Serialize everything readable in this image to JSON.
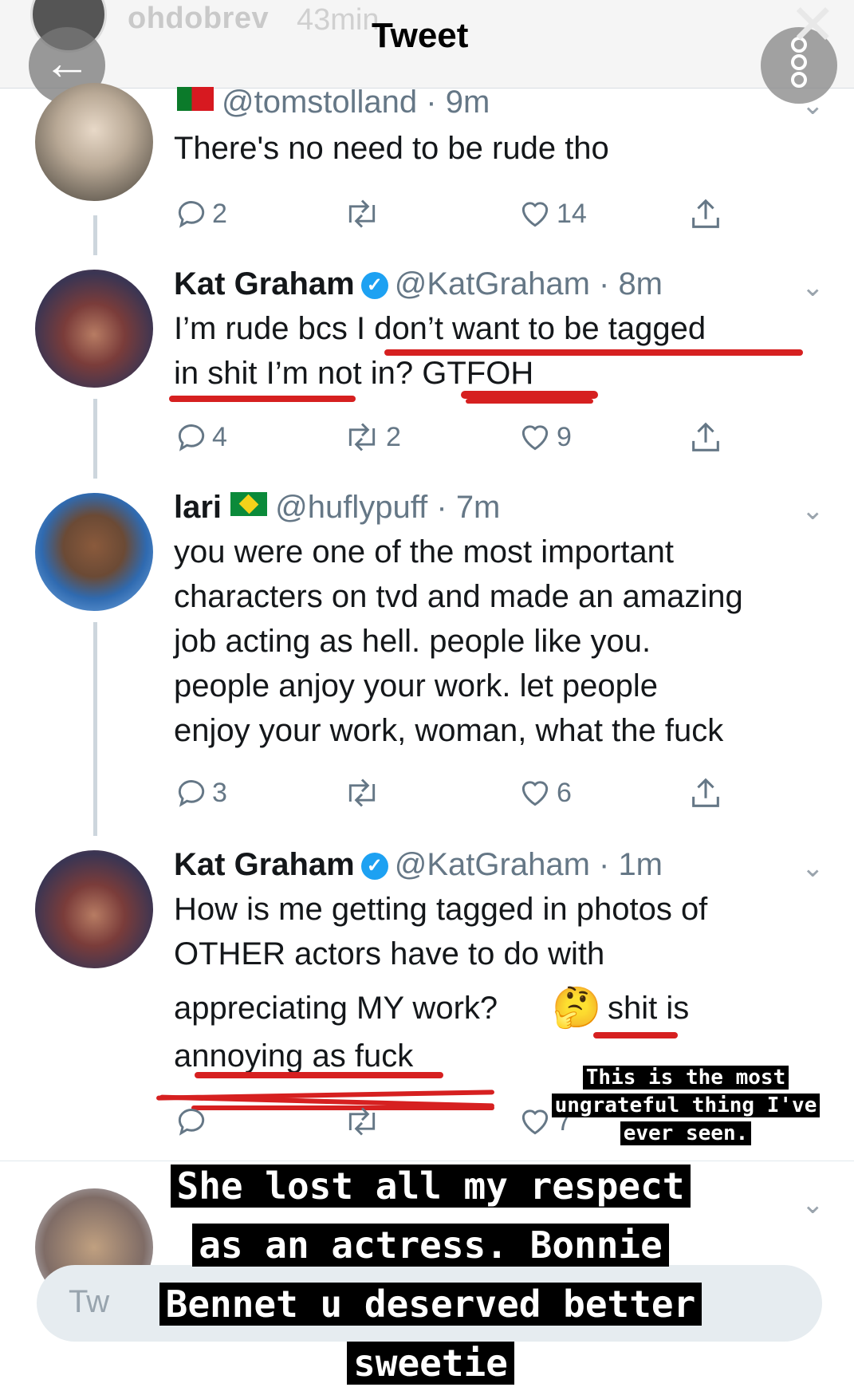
{
  "story": {
    "username": "ohdobrev",
    "time": "43min"
  },
  "header": {
    "title": "Tweet",
    "back_icon": "arrow-left-icon",
    "more_icon": "more-dots-icon",
    "close_icon": "close-icon"
  },
  "tweets": [
    {
      "handle": "@tomstolland",
      "time": "9m",
      "flag": "portugal-flag-icon",
      "text": "There's no need to be rude tho",
      "replies": "2",
      "retweets": "",
      "likes": "14"
    },
    {
      "name": "Kat Graham",
      "handle": "@KatGraham",
      "time": "8m",
      "verified": true,
      "text_line1": "I’m rude bcs I don’t want to be tagged",
      "text_line2": "in shit I’m not in? GTFOH",
      "replies": "4",
      "retweets": "2",
      "likes": "9"
    },
    {
      "name": "lari",
      "handle": "@huflypuff",
      "time": "7m",
      "flag": "brazil-flag-icon",
      "text_lines": [
        "you were one of the most important",
        "characters on tvd and made an amazing",
        "job acting as hell. people like you.",
        "people anjoy your work. let people",
        "enjoy your work, woman, what the fuck"
      ],
      "replies": "3",
      "retweets": "",
      "likes": "6"
    },
    {
      "name": "Kat Graham",
      "handle": "@KatGraham",
      "time": "1m",
      "verified": true,
      "text_lines": [
        "How is me getting tagged in photos of",
        "OTHER actors have to do with",
        "appreciating MY work?",
        "shit is",
        "annoying as fuck"
      ],
      "emoji": "🤔",
      "likes": "7"
    }
  ],
  "captions": {
    "small": [
      "This is the most",
      "ungrateful thing I've",
      "ever seen."
    ],
    "big": [
      "She lost all my respect",
      "as an actress. Bonnie",
      "Bennet u deserved better",
      "sweetie"
    ]
  },
  "reply_placeholder": "Tw",
  "colors": {
    "marker_red": "#d62020",
    "verified_blue": "#1da1f2",
    "muted": "#657786"
  }
}
